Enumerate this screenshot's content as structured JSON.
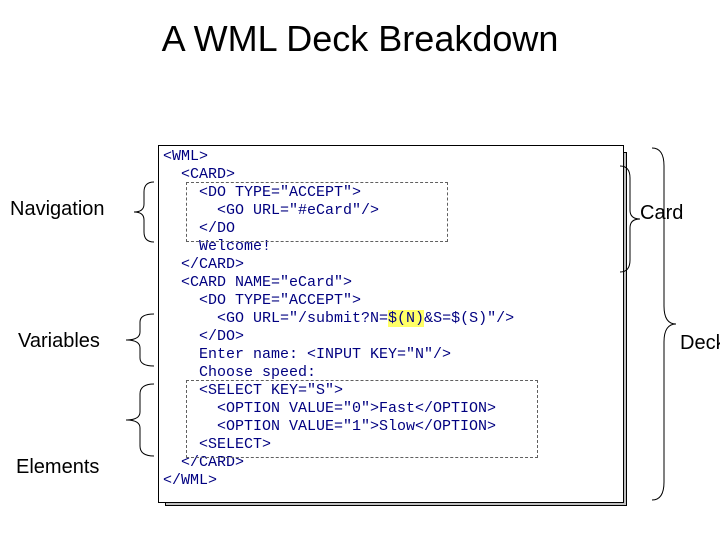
{
  "title": "A WML Deck Breakdown",
  "labels": {
    "navigation": "Navigation",
    "variables": "Variables",
    "elements": "Elements",
    "card": "Card",
    "deck": "Deck"
  },
  "code": {
    "l1": "<WML>",
    "l2": "  <CARD>",
    "l3": "    <DO TYPE=\"ACCEPT\">",
    "l4": "      <GO URL=\"#eCard\"/>",
    "l5": "    </DO",
    "l6": "    Welcome!",
    "l7": "  </CARD>",
    "l8": "  <CARD NAME=\"eCard\">",
    "l9": "    <DO TYPE=\"ACCEPT\">",
    "l10a": "      <GO URL=\"/submit?N=",
    "l10b": "$(N)",
    "l10c": "&S=$(S)\"/>",
    "l11": "    </DO>",
    "l12": "    Enter name: <INPUT KEY=\"N\"/>",
    "l13": "    Choose speed:",
    "l14": "    <SELECT KEY=\"S\">",
    "l15": "      <OPTION VALUE=\"0\">Fast</OPTION>",
    "l16": "      <OPTION VALUE=\"1\">Slow</OPTION>",
    "l17": "    <SELECT>",
    "l18": "  </CARD>",
    "l19": "</WML>"
  }
}
